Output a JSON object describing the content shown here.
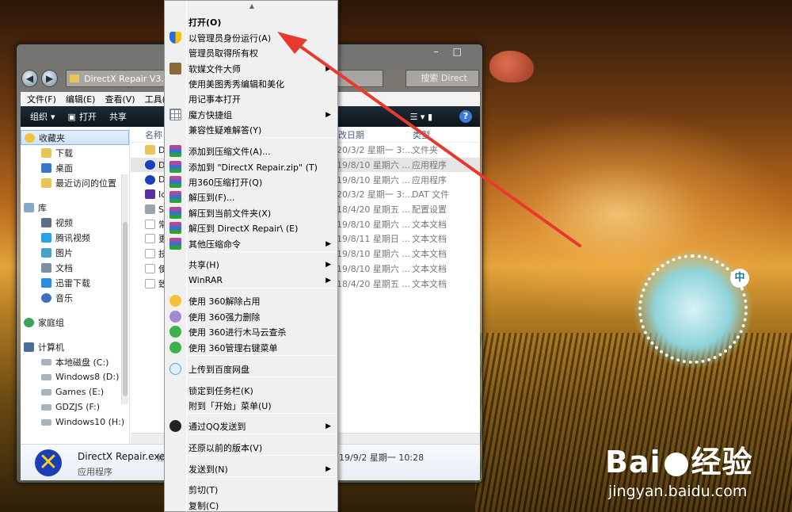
{
  "explorer": {
    "address": "DirectX Repair V3.",
    "search_placeholder": "搜索 Direct",
    "menubar": [
      "文件(F)",
      "编辑(E)",
      "查看(V)",
      "工具("
    ],
    "toolbar": {
      "organize": "组织",
      "open": "打开",
      "share": "共享"
    },
    "window_controls": {
      "minimize": "–",
      "maximize": "□",
      "close": ""
    },
    "sidebar": {
      "favorites": {
        "label": "收藏夹",
        "items": [
          "下载",
          "桌面",
          "最近访问的位置"
        ]
      },
      "libraries": {
        "label": "库",
        "items": [
          "视频",
          "腾讯视频",
          "图片",
          "文档",
          "迅雷下载",
          "音乐"
        ]
      },
      "homegroup": "家庭组",
      "computer": {
        "label": "计算机",
        "drives": [
          "本地磁盘 (C:)",
          "Windows8 (D:)",
          "Games (E:)",
          "GDZJS (F:)",
          "Windows10 (H:)"
        ]
      }
    },
    "columns": {
      "name": "名称",
      "date": "改日期",
      "type": "类型"
    },
    "rows": [
      {
        "name": "D",
        "date": "20/3/2 星期一 3:...",
        "type": "文件夹"
      },
      {
        "name": "D",
        "date": "19/8/10 星期六 ...",
        "type": "应用程序"
      },
      {
        "name": "D",
        "date": "19/8/10 星期六 ...",
        "type": "应用程序"
      },
      {
        "name": "Ic",
        "date": "20/3/2 星期一 3:...",
        "type": "DAT 文件"
      },
      {
        "name": "S",
        "date": "18/4/20 星期五 ...",
        "type": "配置设置"
      },
      {
        "name": "常",
        "date": "19/8/10 星期六 ...",
        "type": "文本文档"
      },
      {
        "name": "更",
        "date": "19/8/11 星期日 ...",
        "type": "文本文档"
      },
      {
        "name": "技",
        "date": "19/8/10 星期六 ...",
        "type": "文本文档"
      },
      {
        "name": "使",
        "date": "19/8/10 星期六 ...",
        "type": "文本文档"
      },
      {
        "name": "致",
        "date": "18/4/20 星期五 ...",
        "type": "文本文档"
      }
    ],
    "details": {
      "filename": "DirectX Repair.exe",
      "modified_label": "修改",
      "type": "应用程序",
      "date": "19/9/2 星期一 10:28"
    }
  },
  "context_menu": {
    "items": [
      {
        "label": "打开(O)",
        "icon": "none",
        "bold": true,
        "submenu": false
      },
      {
        "label": "以管理员身份运行(A)",
        "icon": "uac-shield-icon",
        "submenu": false
      },
      {
        "label": "管理员取得所有权",
        "icon": "none",
        "submenu": false
      },
      {
        "label": "软媒文件大师",
        "icon": "media-file-icon",
        "submenu": true
      },
      {
        "label": "使用美图秀秀编辑和美化",
        "icon": "none",
        "submenu": false
      },
      {
        "label": "用记事本打开",
        "icon": "none",
        "submenu": false
      },
      {
        "label": "魔方快捷组",
        "icon": "grid-icon",
        "submenu": true
      },
      {
        "label": "兼容性疑难解答(Y)",
        "icon": "none",
        "submenu": false
      },
      {
        "label": "添加到压缩文件(A)...",
        "icon": "winrar-icon",
        "submenu": false
      },
      {
        "label": "添加到 \"DirectX Repair.zip\" (T)",
        "icon": "winrar-icon",
        "submenu": false
      },
      {
        "label": "用360压缩打开(Q)",
        "icon": "winrar-icon",
        "submenu": false
      },
      {
        "label": "解压到(F)...",
        "icon": "winrar-icon",
        "submenu": false
      },
      {
        "label": "解压到当前文件夹(X)",
        "icon": "winrar-icon",
        "submenu": false
      },
      {
        "label": "解压到 DirectX Repair\\ (E)",
        "icon": "winrar-icon",
        "submenu": false
      },
      {
        "label": "其他压缩命令",
        "icon": "winrar-icon",
        "submenu": true
      },
      {
        "label": "共享(H)",
        "icon": "none",
        "submenu": true
      },
      {
        "label": "WinRAR",
        "icon": "none",
        "submenu": true
      },
      {
        "label": "使用 360解除占用",
        "icon": "360-unlock-icon",
        "submenu": false
      },
      {
        "label": "使用 360强力删除",
        "icon": "360-delete-icon",
        "submenu": false
      },
      {
        "label": "使用 360进行木马云查杀",
        "icon": "360-scan-icon",
        "submenu": false
      },
      {
        "label": "使用 360管理右键菜单",
        "icon": "360-manage-icon",
        "submenu": false
      },
      {
        "label": "上传到百度网盘",
        "icon": "baidu-cloud-icon",
        "submenu": false
      },
      {
        "label": "锁定到任务栏(K)",
        "icon": "none",
        "submenu": false
      },
      {
        "label": "附到「开始」菜单(U)",
        "icon": "none",
        "submenu": false
      },
      {
        "label": "通过QQ发送到",
        "icon": "qq-icon",
        "submenu": true
      },
      {
        "label": "还原以前的版本(V)",
        "icon": "none",
        "submenu": false
      },
      {
        "label": "发送到(N)",
        "icon": "none",
        "submenu": true
      },
      {
        "label": "剪切(T)",
        "icon": "none",
        "submenu": false
      },
      {
        "label": "复制(C)",
        "icon": "none",
        "submenu": false
      }
    ]
  },
  "watermark": {
    "brand": "Bai",
    "brand2": "经验",
    "url": "jingyan.baidu.com"
  },
  "sticker_badge": "中",
  "colors": {
    "annotation_arrow": "#e8392f",
    "selection": "#e5e5e5",
    "toolbar": "#142029"
  }
}
